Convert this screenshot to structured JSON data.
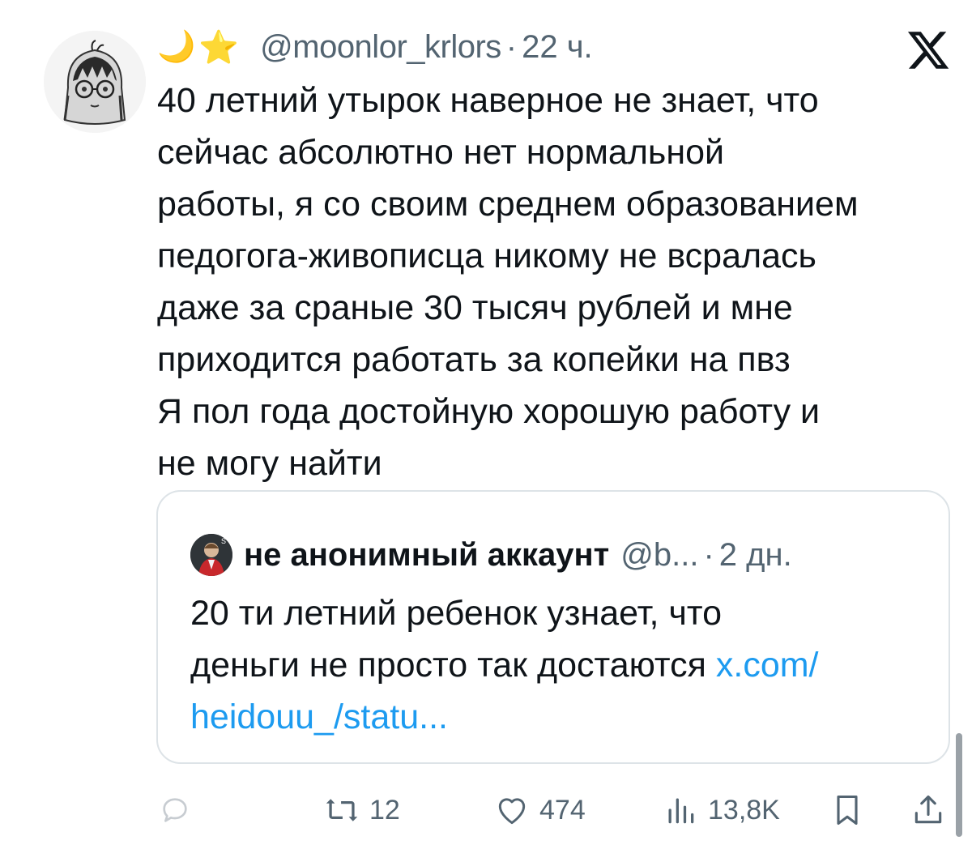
{
  "tweet": {
    "emoji_moon": "🌙",
    "emoji_star": "⭐",
    "handle": "@moonlor_krlors",
    "separator": "·",
    "time": "22 ч.",
    "text_lines": [
      "40 летний утырок наверное не знает, что",
      "сейчас абсолютно нет нормальной",
      "работы, я со своим среднем образованием",
      "педогога-живописца никому не всралась",
      "даже за сраные 30 тысяч рублей и мне",
      "приходится работать за копейки на пвз",
      "Я пол года достойную хорошую работу и",
      "не могу найти"
    ]
  },
  "quoted": {
    "name": "не анонимный аккаунт",
    "handle": "@b...",
    "separator": "·",
    "time": "2 дн.",
    "text_line1": "20 ти летний ребенок узнает, что",
    "text_line2": "деньги не просто так достаются ",
    "link_part1": "x.com/",
    "link_part2": "heidouu_/statu..."
  },
  "actions": {
    "reply_count": "",
    "retweet_count": "12",
    "like_count": "474",
    "views_count": "13,8K"
  },
  "icons": {
    "x_logo": "x-logo-icon",
    "reply": "reply-icon",
    "retweet": "retweet-icon",
    "like": "heart-icon",
    "views": "views-icon",
    "bookmark": "bookmark-icon",
    "share": "share-icon"
  },
  "colors": {
    "text": "#0f1419",
    "secondary": "#536471",
    "link": "#1d9bf0",
    "border": "#dde3e7"
  }
}
